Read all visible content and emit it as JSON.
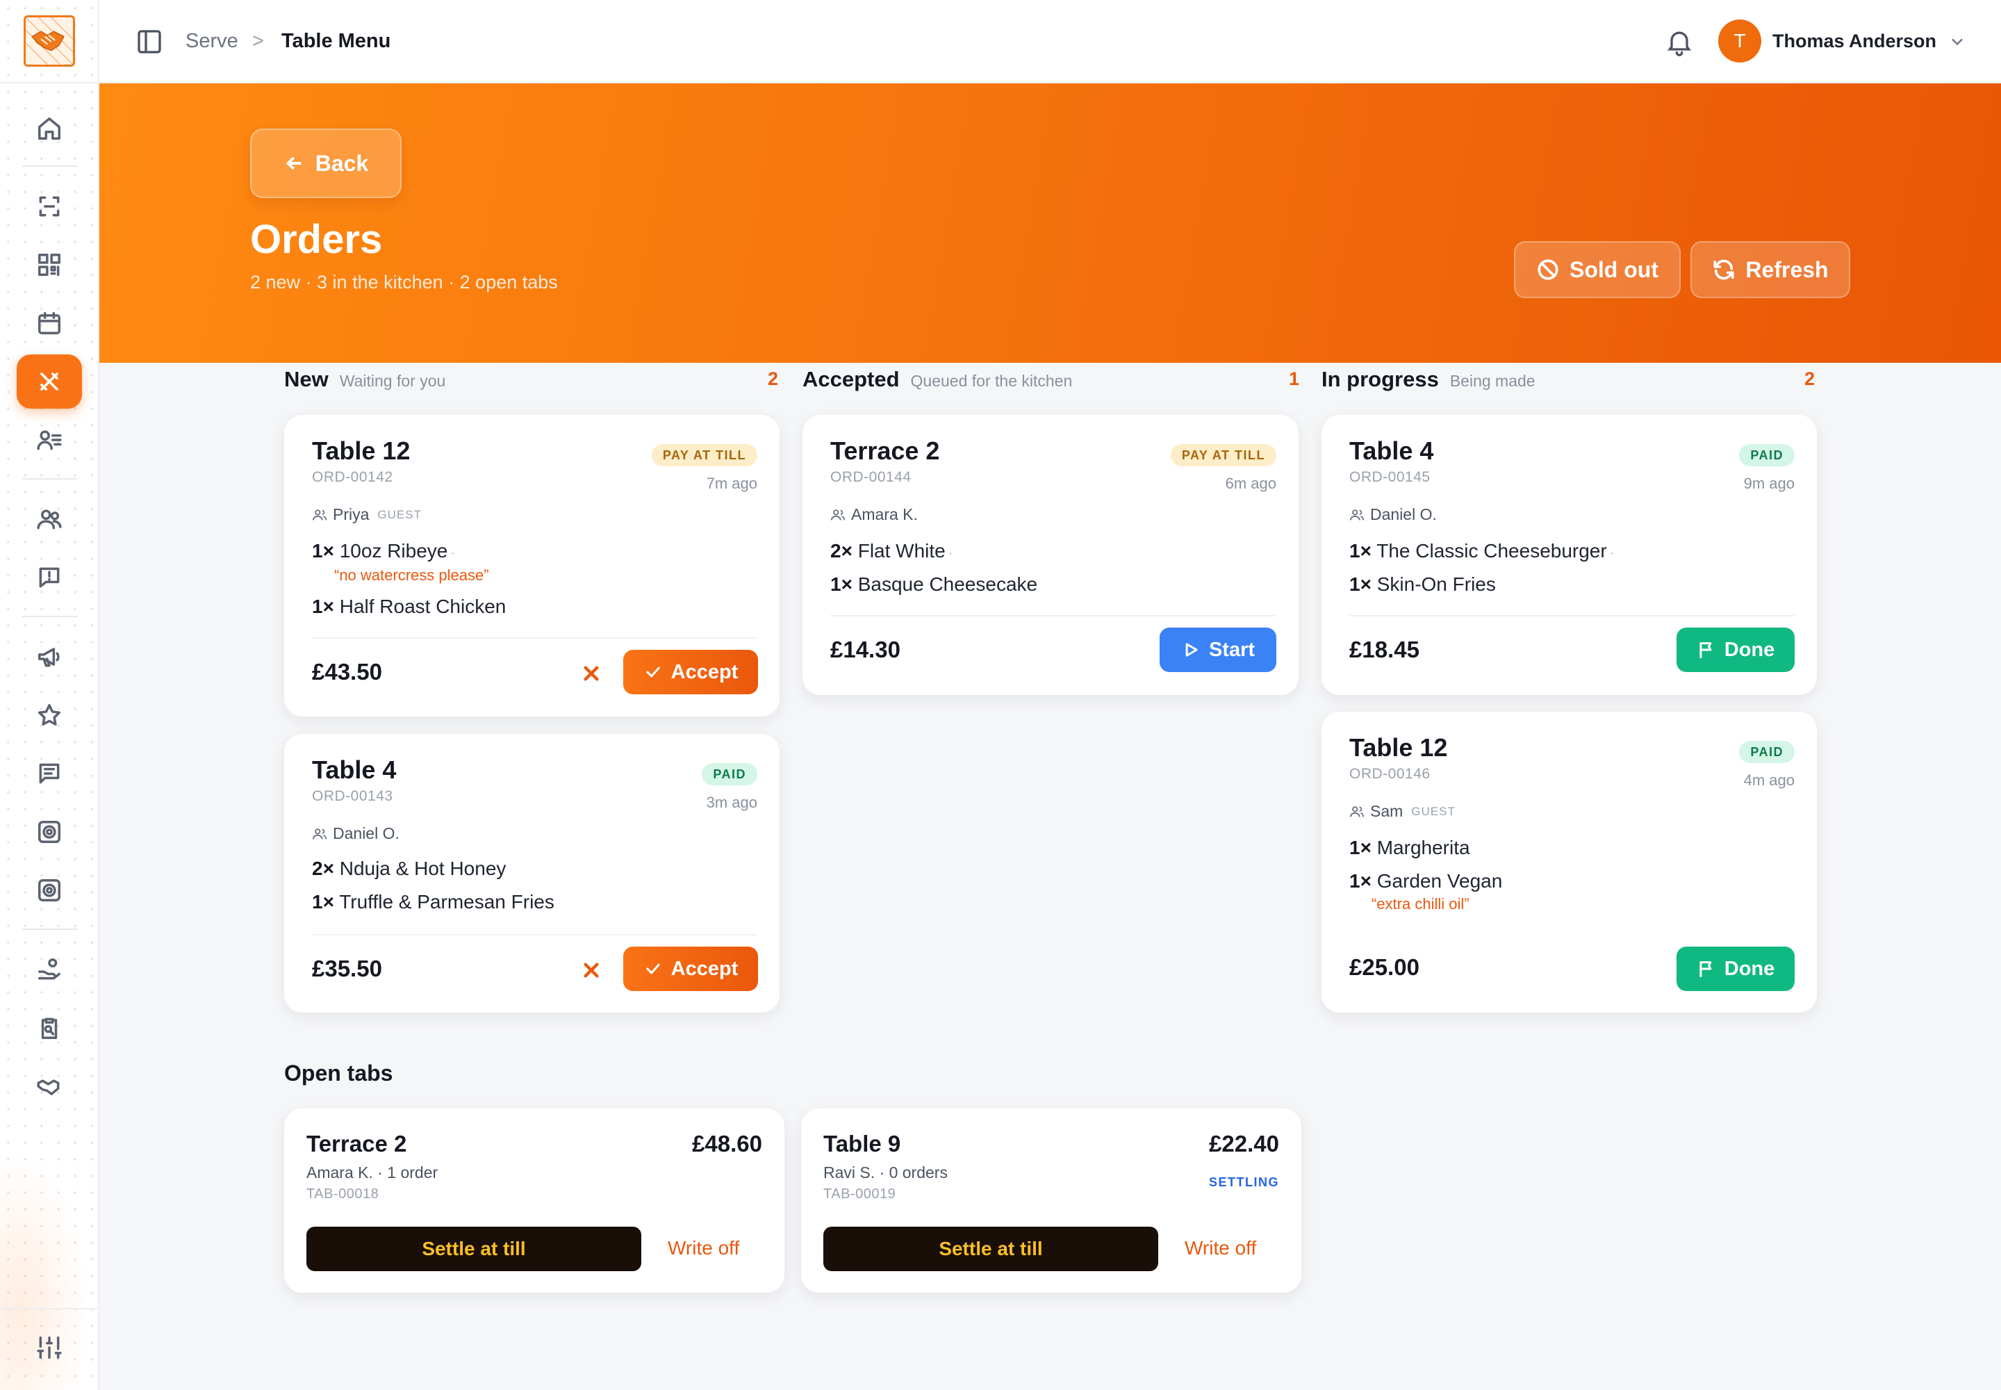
{
  "header": {
    "breadcrumb": [
      "Serve",
      "Table Menu"
    ],
    "breadcrumb_sep": ">",
    "user": {
      "initial": "T",
      "name": "Thomas Anderson"
    }
  },
  "sidebar": {
    "items": [
      {
        "name": "home-icon"
      },
      {
        "name": "scan-icon"
      },
      {
        "name": "qr-code-icon"
      },
      {
        "name": "calendar-icon"
      },
      {
        "name": "utensils-icon",
        "active": true
      },
      {
        "name": "contacts-icon"
      },
      {
        "name": "users-icon"
      },
      {
        "name": "message-alert-icon"
      },
      {
        "name": "megaphone-icon"
      },
      {
        "name": "star-icon"
      },
      {
        "name": "message-square-icon"
      },
      {
        "name": "target-icon"
      },
      {
        "name": "target-alt-icon"
      },
      {
        "name": "hand-coins-icon"
      },
      {
        "name": "clipboard-search-icon"
      },
      {
        "name": "handshake-icon"
      },
      {
        "name": "sliders-icon"
      }
    ]
  },
  "hero": {
    "back_label": "Back",
    "title": "Orders",
    "subtitle": "2 new · 3 in the kitchen · 2 open tabs",
    "sold_out_label": "Sold out",
    "refresh_label": "Refresh"
  },
  "columns": [
    {
      "title": "New",
      "subtitle": "Waiting for you",
      "count": "2",
      "cards": [
        {
          "table": "Table 12",
          "order_id": "ORD-00142",
          "badge": "PAY AT TILL",
          "ago": "7m ago",
          "customer": "Priya",
          "guest_tag": "GUEST",
          "items": [
            {
              "qty": "1×",
              "name": "10oz Ribeye",
              "note": "“no watercress please”"
            },
            {
              "qty": "1×",
              "name": "Half Roast Chicken"
            }
          ],
          "total": "£43.50",
          "action": "Accept"
        },
        {
          "table": "Table 4",
          "order_id": "ORD-00143",
          "badge": "PAID",
          "ago": "3m ago",
          "customer": "Daniel O.",
          "items": [
            {
              "qty": "2×",
              "name": "Nduja & Hot Honey"
            },
            {
              "qty": "1×",
              "name": "Truffle & Parmesan Fries"
            }
          ],
          "total": "£35.50",
          "action": "Accept"
        }
      ]
    },
    {
      "title": "Accepted",
      "subtitle": "Queued for the kitchen",
      "count": "1",
      "cards": [
        {
          "table": "Terrace 2",
          "order_id": "ORD-00144",
          "badge": "PAY AT TILL",
          "ago": "6m ago",
          "customer": "Amara K.",
          "items": [
            {
              "qty": "2×",
              "name": "Flat White"
            },
            {
              "qty": "1×",
              "name": "Basque Cheesecake"
            }
          ],
          "total": "£14.30",
          "action": "Start"
        }
      ]
    },
    {
      "title": "In progress",
      "subtitle": "Being made",
      "count": "2",
      "cards": [
        {
          "table": "Table 4",
          "order_id": "ORD-00145",
          "badge": "PAID",
          "ago": "9m ago",
          "customer": "Daniel O.",
          "items": [
            {
              "qty": "1×",
              "name": "The Classic Cheeseburger"
            },
            {
              "qty": "1×",
              "name": "Skin-On Fries"
            }
          ],
          "total": "£18.45",
          "action": "Done"
        },
        {
          "table": "Table 12",
          "order_id": "ORD-00146",
          "badge": "PAID",
          "ago": "4m ago",
          "customer": "Sam",
          "guest_tag": "GUEST",
          "items": [
            {
              "qty": "1×",
              "name": "Margherita"
            },
            {
              "qty": "1×",
              "name": "Garden Vegan",
              "note": "“extra chilli oil”"
            }
          ],
          "total": "£25.00",
          "action": "Done"
        }
      ]
    }
  ],
  "open_tabs": {
    "title": "Open tabs",
    "tabs": [
      {
        "name": "Terrace 2",
        "amount": "£48.60",
        "meta": "Amara K. · 1 order",
        "tab_id": "TAB-00018",
        "status": "",
        "settle_label": "Settle at till",
        "writeoff_label": "Write off"
      },
      {
        "name": "Table 9",
        "amount": "£22.40",
        "meta": "Ravi S. · 0 orders",
        "tab_id": "TAB-00019",
        "status": "SETTLING",
        "settle_label": "Settle at till",
        "writeoff_label": "Write off"
      }
    ]
  },
  "colors": {
    "accent": "#f97316",
    "accent_dark": "#ea580c",
    "start": "#3b82f6",
    "done": "#10b981",
    "settle_bg": "#1a0e09",
    "settle_text": "#fbbf24"
  }
}
